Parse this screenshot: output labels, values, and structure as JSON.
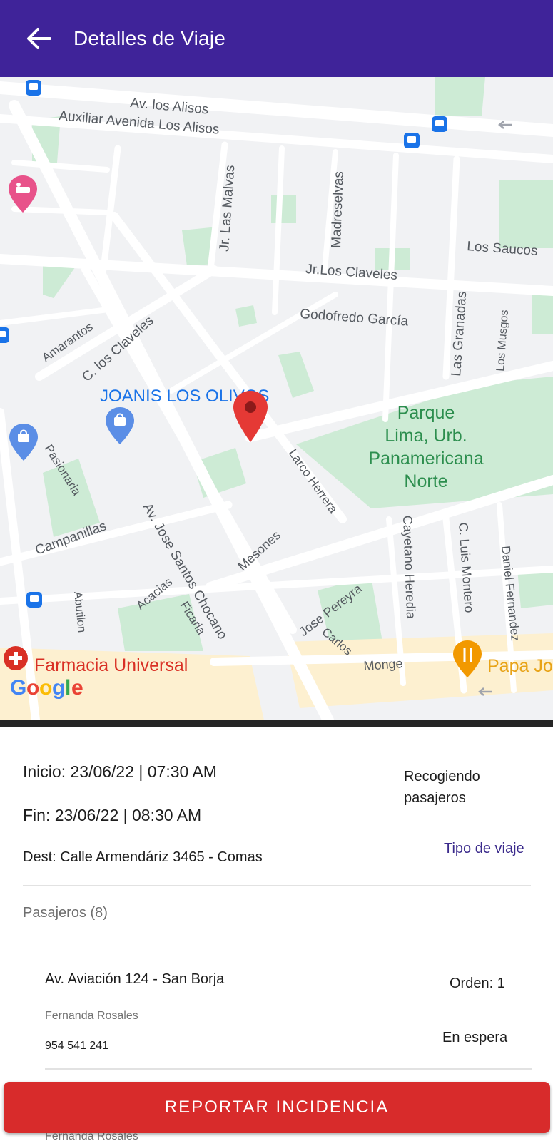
{
  "appbar": {
    "title": "Detalles de Viaje",
    "back_icon": "arrow-left-icon",
    "color": "#3f2399"
  },
  "map": {
    "streets": {
      "alisos": "Av. los Alisos",
      "auxiliar": "Auxiliar Avenida Los Alisos",
      "malvas": "Jr. Las Malvas",
      "madreselvas": "Madreselvas",
      "saucos": "Los Saucos",
      "claveles_jr": "Jr.Los Claveles",
      "godofredo": "Godofredo García",
      "granadas": "Las Granadas",
      "musgos": "Los Musgos",
      "amarantos": "Amarantos",
      "claveles_c": "C. los Claveles",
      "pasionaria": "Pasionaria",
      "campanillas": "Campanillas",
      "chocano": "Av. Jose Santos Chocano",
      "mesones": "Mesones",
      "larco": "Larco Herrera",
      "cayetano": "Cayetano Heredia",
      "montero": "C. Luis Montero",
      "daniel": "Daniel Fernandez",
      "pereyra": "Jose Pereyra",
      "carlos": "Carlos",
      "monge": "Monge",
      "acacias": "Acacias",
      "ficaria": "Ficaria",
      "abutilon": "Abutilon"
    },
    "places": {
      "joanis": "JOANIS LOS OLIVOS",
      "parque": [
        "Parque",
        "Lima, Urb.",
        "Panamericana",
        "Norte"
      ],
      "farmacia": "Farmacia Universal",
      "papa": "Papa Jo"
    },
    "google": [
      "G",
      "o",
      "o",
      "g",
      "l",
      "e"
    ],
    "colors": {
      "background": "#f1f2f4",
      "road": "#ffffff",
      "park": "#cdebd5",
      "park_label": "#2c8e4e",
      "poi_label": "#1a73e8",
      "marker": "#e53935",
      "farmacia": "#d93025",
      "papa": "#e8a317"
    },
    "icons": [
      "location-pin-icon",
      "bus-stop-icon",
      "hotel-icon",
      "shopping-icon",
      "pharmacy-icon",
      "restaurant-icon"
    ]
  },
  "trip": {
    "inicio": "Inicio: 23/06/22 | 07:30 AM",
    "fin": "Fin: 23/06/22 | 08:30 AM",
    "dest": "Dest: Calle Armendáriz 3465 - Comas",
    "status": "Recogiendo pasajeros",
    "tipo_link": "Tipo de viaje"
  },
  "pasajeros": {
    "title": "Pasajeros (8)",
    "items": [
      {
        "address": "Av. Aviación 124 - San Borja",
        "name": "Fernanda Rosales",
        "phone": "954 541 241",
        "order": "Orden: 1",
        "state": "En espera"
      }
    ],
    "peek_name": "Fernanda Rosales"
  },
  "report_button": {
    "label": "REPORTAR INCIDENCIA",
    "color": "#d82b2b"
  }
}
